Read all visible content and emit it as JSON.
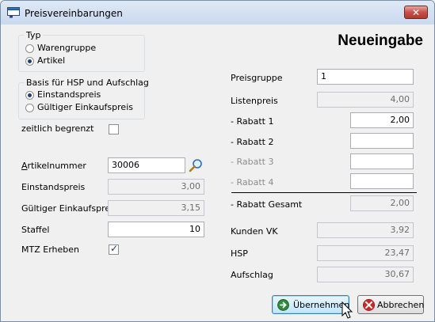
{
  "window": {
    "title": "Preisvereinbarungen",
    "close_symbol": "✕"
  },
  "heading": "Neueingabe",
  "typ": {
    "title": "Typ",
    "options": [
      {
        "label": "Warengruppe",
        "selected": false
      },
      {
        "label": "Artikel",
        "selected": true
      }
    ]
  },
  "basis": {
    "title": "Basis für HSP und Aufschlag",
    "options": [
      {
        "label": "Einstandspreis",
        "selected": true
      },
      {
        "label": "Gültiger Einkaufspreis",
        "selected": false
      }
    ]
  },
  "zeitlich": {
    "label": "zeitlich begrenzt",
    "checked": false
  },
  "left_fields": {
    "artikelnummer": {
      "label": "Artikelnummer",
      "value": "30006"
    },
    "einstandspreis": {
      "label": "Einstandspreis",
      "value": "3,00"
    },
    "gueltiger_ek": {
      "label": "Gültiger Einkaufspreis",
      "value": "3,15"
    },
    "staffel": {
      "label": "Staffel",
      "value": "10"
    },
    "mtz": {
      "label": "MTZ Erheben",
      "checked": true
    }
  },
  "right_fields": {
    "preisgruppe": {
      "label": "Preisgruppe",
      "value": "1"
    },
    "listenpreis": {
      "label": "Listenpreis",
      "value": "4,00"
    },
    "rabatt1": {
      "label": "- Rabatt 1",
      "value": "2,00"
    },
    "rabatt2": {
      "label": "- Rabatt 2",
      "value": ""
    },
    "rabatt3": {
      "label": "- Rabatt 3",
      "value": ""
    },
    "rabatt4": {
      "label": "- Rabatt 4",
      "value": ""
    },
    "rabatt_gesamt": {
      "label": "- Rabatt Gesamt",
      "value": "2,00"
    },
    "kunden_vk": {
      "label": "Kunden VK",
      "value": "3,92"
    },
    "hsp": {
      "label": "HSP",
      "value": "23,47"
    },
    "aufschlag": {
      "label": "Aufschlag",
      "value": "30,67"
    }
  },
  "buttons": {
    "ok": "Übernehmen",
    "cancel": "Abbrechen"
  },
  "colors": {
    "ok_icon": "#2e8b3a",
    "cancel_icon": "#c62828"
  }
}
